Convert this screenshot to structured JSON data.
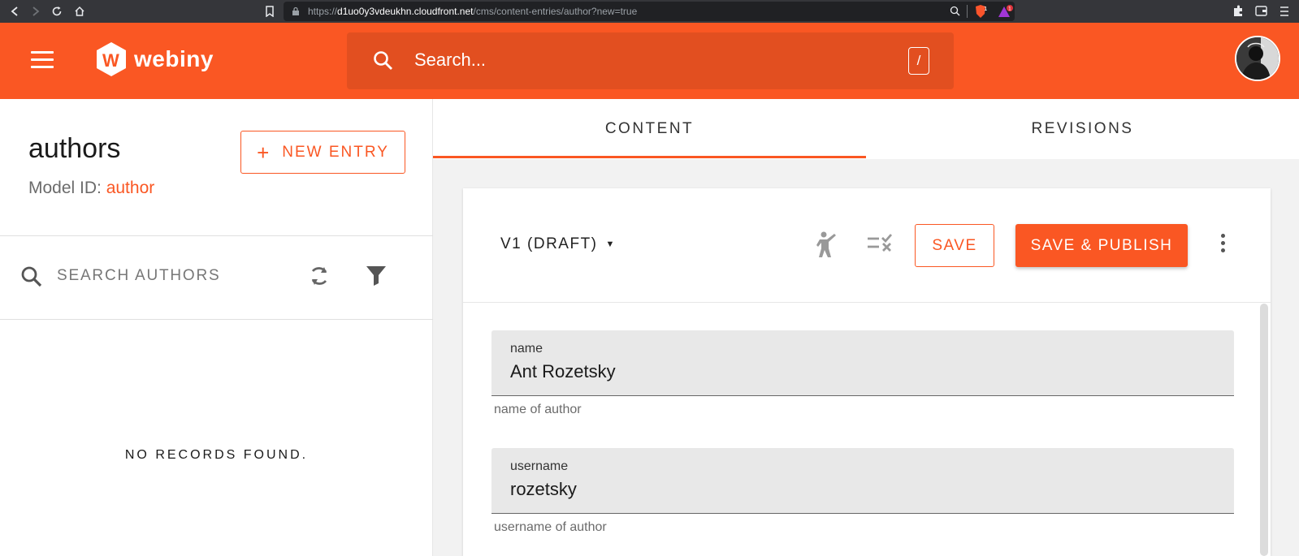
{
  "browser": {
    "url_prefix": "https://",
    "url_host": "d1uo0y3vdeukhn.cloudfront.net",
    "url_path": "/cms/content-entries/author?new=true",
    "brave_badge": "1",
    "rewards_badge": "1"
  },
  "header": {
    "logo_text": "webiny",
    "search_placeholder": "Search...",
    "search_shortcut": "/"
  },
  "left": {
    "model_title": "authors",
    "model_id_label": "Model ID: ",
    "model_id_value": "author",
    "new_entry_label": "NEW ENTRY",
    "search_placeholder": "SEARCH AUTHORS",
    "empty_message": "NO RECORDS FOUND."
  },
  "tabs": [
    {
      "label": "CONTENT",
      "active": true
    },
    {
      "label": "REVISIONS",
      "active": false
    }
  ],
  "toolbar": {
    "revision_label": "V1 (DRAFT)",
    "save_label": "SAVE",
    "publish_label": "SAVE & PUBLISH"
  },
  "form": {
    "fields": [
      {
        "label": "name",
        "value": "Ant Rozetsky",
        "help": "name of author"
      },
      {
        "label": "username",
        "value": "rozetsky",
        "help": "username of author"
      }
    ]
  },
  "colors": {
    "brand": "#fa5723",
    "header_search_bg": "#e24f20",
    "browser_chrome": "#35363a"
  }
}
